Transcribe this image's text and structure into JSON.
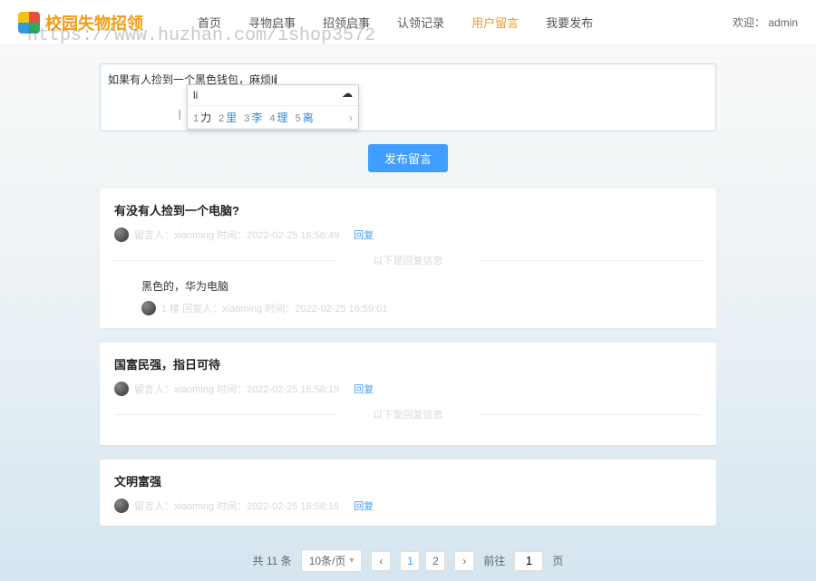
{
  "header": {
    "logo_text": "校园失物招领",
    "nav": [
      {
        "label": "首页",
        "active": false
      },
      {
        "label": "寻物启事",
        "active": false
      },
      {
        "label": "招领启事",
        "active": false
      },
      {
        "label": "认领记录",
        "active": false
      },
      {
        "label": "用户留言",
        "active": true
      },
      {
        "label": "我要发布",
        "active": false
      }
    ],
    "welcome_prefix": "欢迎：",
    "welcome_user": "admin"
  },
  "watermark": "https://www.huzhan.com/ishop3572",
  "compose": {
    "text": "如果有人捡到一个黑色钱包，麻烦li",
    "ime": {
      "input": "li",
      "cloud_icon": "☁",
      "candidates": [
        {
          "num": "1",
          "text": "力",
          "blue": false
        },
        {
          "num": "2",
          "text": "里",
          "blue": true
        },
        {
          "num": "3",
          "text": "李",
          "blue": true
        },
        {
          "num": "4",
          "text": "理",
          "blue": true
        },
        {
          "num": "5",
          "text": "离",
          "blue": true
        }
      ],
      "arrow": "›"
    },
    "publish_btn": "发布留言"
  },
  "posts": [
    {
      "title": "有没有人捡到一个电脑?",
      "meta_text": "留言人：xiaoming 时间：2022-02-25 16:56:49",
      "reply_label": "回复",
      "divider": "以下是回复信息",
      "reply": {
        "content": "黑色的，华为电脑",
        "meta_text": "1 楼 回复人：xiaoming 时间：2022-02-25 16:59:01"
      }
    },
    {
      "title": "国富民强，指日可待",
      "meta_text": "留言人：xiaoming 时间：2022-02-25 16:58:19",
      "reply_label": "回复",
      "divider": "以下是回复信息",
      "reply": null
    },
    {
      "title": "文明富强",
      "meta_text": "留言人：xiaoming 时间：2022-02-25 16:58:15",
      "reply_label": "回复",
      "divider": null,
      "reply": null
    }
  ],
  "pager": {
    "total": "共 11 条",
    "page_size": "10条/页",
    "pages": [
      "1",
      "2"
    ],
    "goto_label": "前往",
    "goto_value": "1",
    "goto_suffix": "页"
  }
}
